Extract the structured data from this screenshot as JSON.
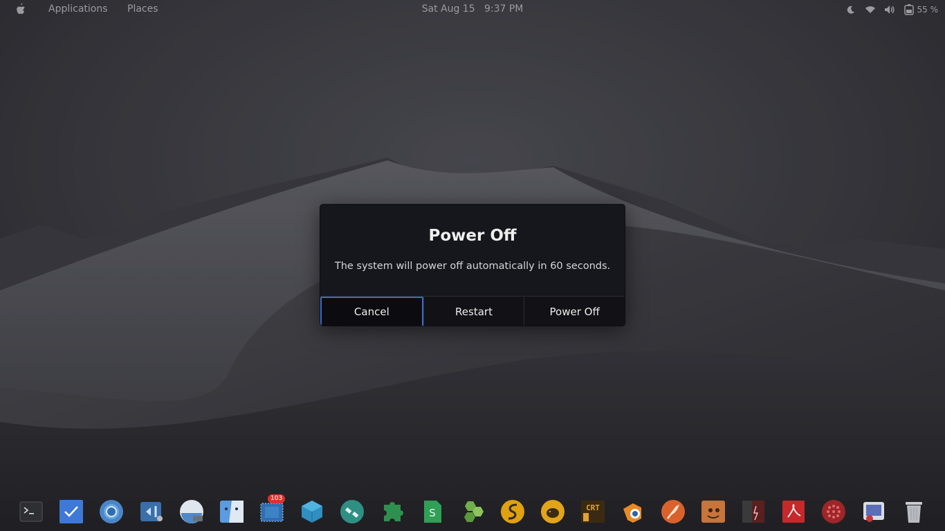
{
  "topbar": {
    "apple_icon": "apple-logo-icon",
    "applications_label": "Applications",
    "places_label": "Places",
    "clock": "Sat Aug 15   9:37 PM",
    "tray": {
      "night_icon": "moon-icon",
      "wifi_icon": "wifi-icon",
      "volume_icon": "volume-icon",
      "battery_icon": "battery-icon",
      "battery_percent": "55 %"
    }
  },
  "dialog": {
    "title": "Power Off",
    "message": "The system will power off automatically in 60 seconds.",
    "buttons": {
      "cancel": "Cancel",
      "restart": "Restart",
      "power_off": "Power Off"
    },
    "focus_color": "#3a6cc6"
  },
  "dock": {
    "items": [
      {
        "name": "terminal-icon"
      },
      {
        "name": "tasks-icon"
      },
      {
        "name": "chromium-icon"
      },
      {
        "name": "vscode-icon"
      },
      {
        "name": "disk-icon"
      },
      {
        "name": "finder-icon"
      },
      {
        "name": "mail-icon",
        "badge": "103"
      },
      {
        "name": "cube-icon"
      },
      {
        "name": "satellite-icon"
      },
      {
        "name": "puzzle-icon"
      },
      {
        "name": "spreadsheet-icon"
      },
      {
        "name": "hexagons-icon"
      },
      {
        "name": "simplenote-icon"
      },
      {
        "name": "piggy-bank-icon"
      },
      {
        "name": "crt-icon"
      },
      {
        "name": "blender-icon"
      },
      {
        "name": "feather-icon"
      },
      {
        "name": "gimp-icon"
      },
      {
        "name": "book-icon"
      },
      {
        "name": "pdf-icon"
      },
      {
        "name": "dots-sphere-icon"
      },
      {
        "name": "screenshot-icon"
      },
      {
        "name": "trash-icon"
      }
    ]
  }
}
